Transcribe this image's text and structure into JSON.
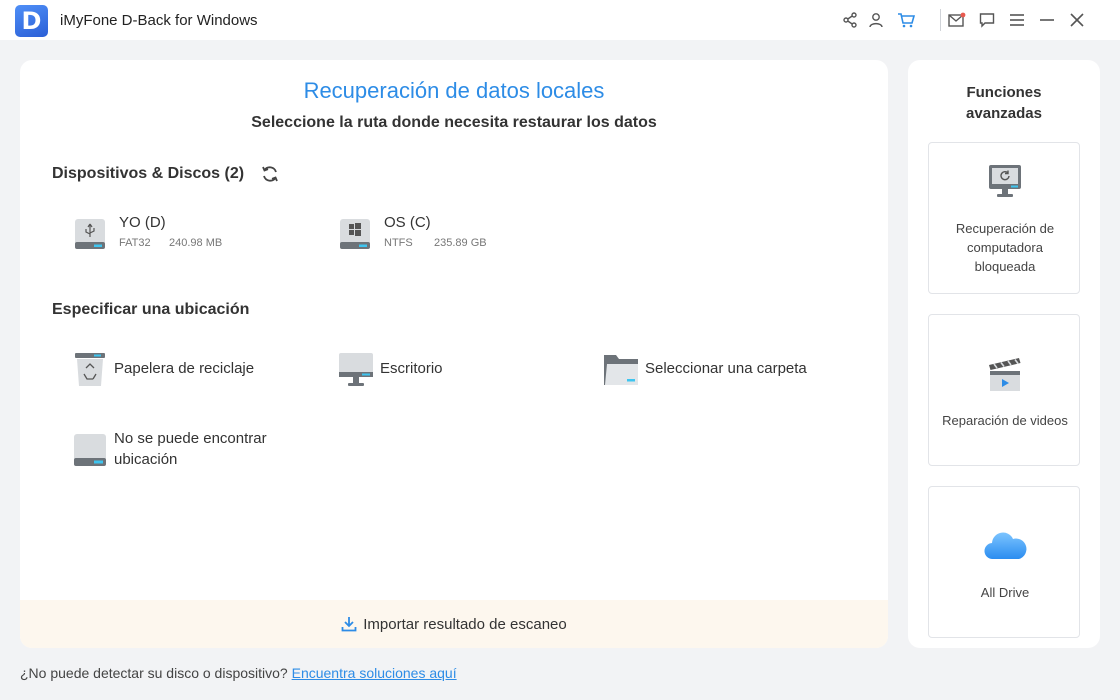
{
  "window": {
    "logo_letter": "D",
    "title": "iMyFone D-Back for Windows",
    "icons": [
      "share-icon",
      "user-icon",
      "cart-icon",
      "mail-icon",
      "feedback-icon",
      "menu-icon",
      "minimize-icon",
      "close-icon"
    ],
    "accent": "#2d8ce6"
  },
  "main": {
    "title": "Recuperación de datos locales",
    "subtitle": "Seleccione la ruta donde necesita restaurar los datos",
    "devices_section": "Dispositivos & Discos (2)",
    "drives": [
      {
        "name": "YO (D)",
        "fs": "FAT32",
        "size": "240.98 MB",
        "icon": "usb-drive-icon"
      },
      {
        "name": "OS (C)",
        "fs": "NTFS",
        "size": "235.89 GB",
        "icon": "windows-drive-icon"
      }
    ],
    "location_section": "Especificar una ubicación",
    "locations": [
      {
        "label": "Papelera de reciclaje",
        "icon": "recycle-bin-icon"
      },
      {
        "label": "Escritorio",
        "icon": "desktop-icon"
      },
      {
        "label": "Seleccionar una carpeta",
        "icon": "folder-icon"
      },
      {
        "label": "No se puede encontrar ubicación",
        "icon": "unknown-drive-icon"
      }
    ],
    "import_label": "Importar resultado de escaneo"
  },
  "side": {
    "title": "Funciones avanzadas",
    "features": [
      {
        "label": "Recuperación de computadora bloqueada",
        "icon": "locked-computer-icon"
      },
      {
        "label": "Reparación de videos",
        "icon": "video-repair-icon"
      },
      {
        "label": "All Drive",
        "icon": "cloud-icon"
      }
    ]
  },
  "footer": {
    "question": "¿No puede detectar su disco o dispositivo?",
    "link": "Encuentra soluciones aquí"
  }
}
